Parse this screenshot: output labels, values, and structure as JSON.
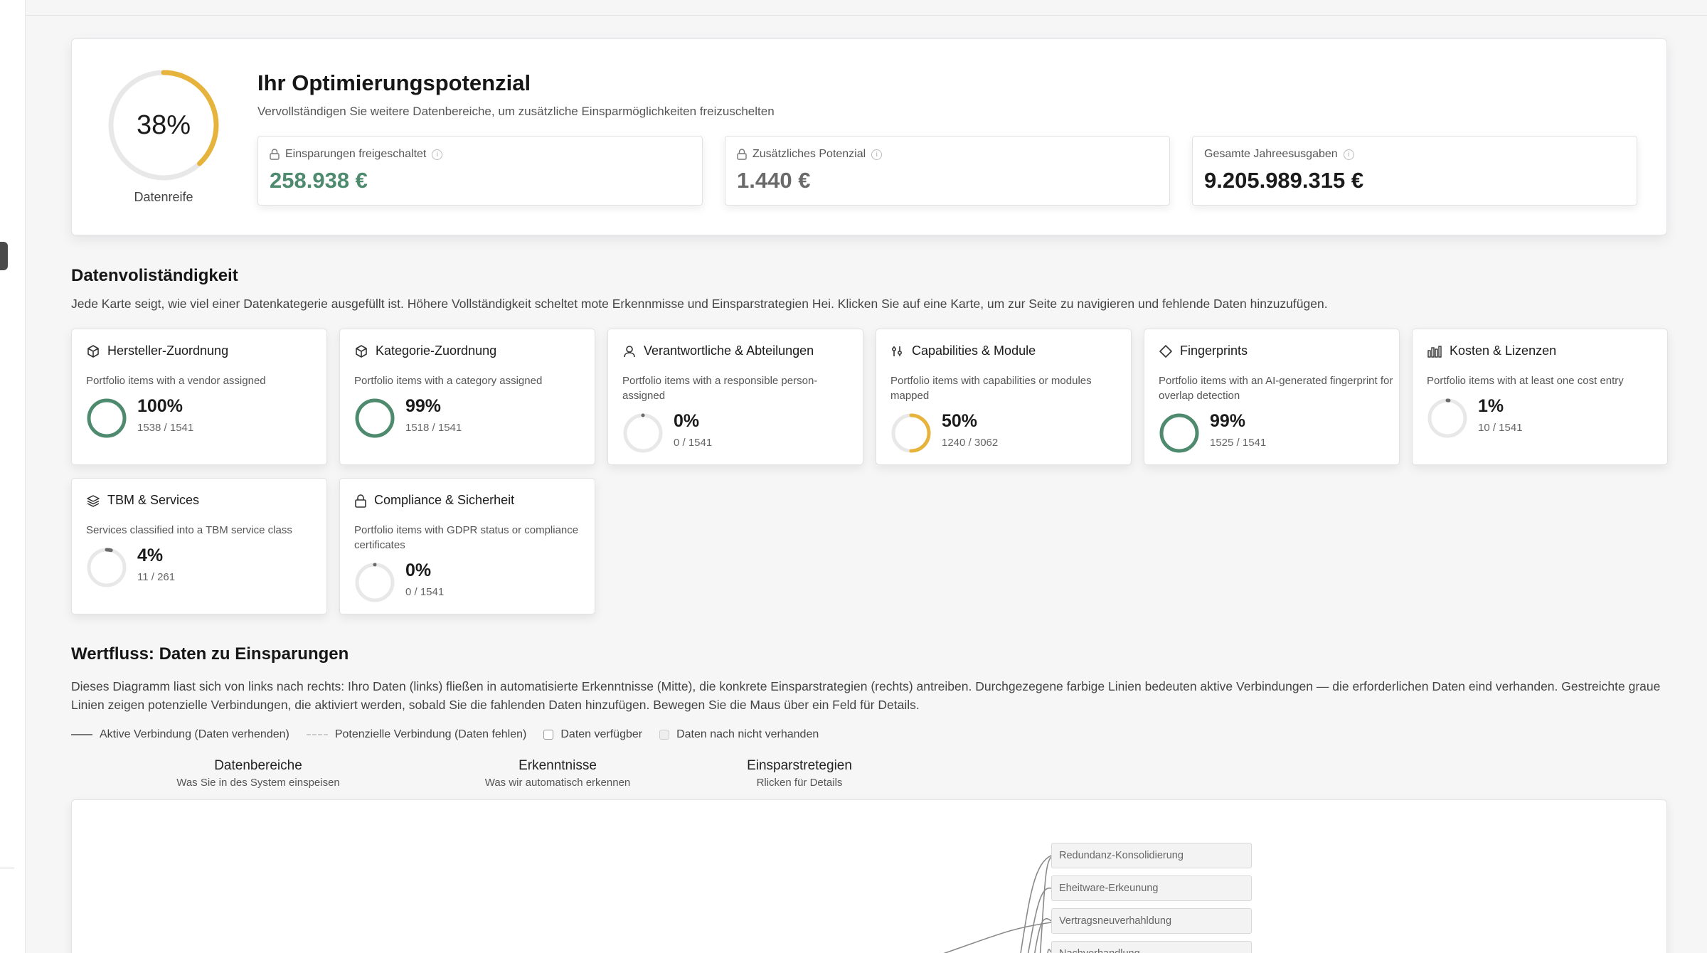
{
  "hero": {
    "maturity_percent": 38,
    "maturity_label": "38%",
    "maturity_caption": "Datenreife",
    "title": "Ihr Optimierungspotenzial",
    "subtitle": "Vervollständigen Sie weitere Datenbereiche, um zusätzliche Einsparmöglichkeiten freizuschelten",
    "stats": [
      {
        "label": "Einsparungen freigeschaltet",
        "value": "258.938 €",
        "color": "#4e8a6e",
        "icon": "lock-icon"
      },
      {
        "label": "Zusätzliches Potenzial",
        "value": "1.440 €",
        "color": "#6a6a6a",
        "icon": "lock-icon"
      },
      {
        "label": "Gesamte Jahreesusgaben",
        "value": "9.205.989.315 €",
        "color": "#1b1b1b",
        "icon": ""
      }
    ]
  },
  "completeness": {
    "title": "Datenvoliständigkeit",
    "description": "Jede Karte seigt, wie viel einer Datenkategerie ausgefüllt ist. Höhere Vollständigkeit scheltet mote Erkennmisse und Einsparstrategien Hei. Klicken Sie auf eine Karte, um zur Seite zu navigieren und fehlende Daten hinzuzufügen.",
    "cards": [
      {
        "title": "Hersteller-Zuordnung",
        "icon": "box-icon",
        "desc": "Portfolio items with a vendor assigned",
        "percent": 100,
        "pct_label": "100%",
        "count": "1538 / 1541"
      },
      {
        "title": "Kategorie-Zuordnung",
        "icon": "box-icon",
        "desc": "Portfolio items with a category assigned",
        "percent": 99,
        "pct_label": "99%",
        "count": "1518 / 1541"
      },
      {
        "title": "Verantwortliche & Abteilungen",
        "icon": "user-icon",
        "desc": "Portfolio items with a responsible person-assigned",
        "percent": 0,
        "pct_label": "0%",
        "count": "0 / 1541"
      },
      {
        "title": "Capabilities & Module",
        "icon": "sliders-icon",
        "desc": "Portfolio items with capabilities or modules mapped",
        "percent": 50,
        "pct_label": "50%",
        "count": "1240 / 3062"
      },
      {
        "title": "Fingerprints",
        "icon": "diamond-icon",
        "desc": "Portfolio items with an AI-generated fingerprint for overlap detection",
        "percent": 99,
        "pct_label": "99%",
        "count": "1525 / 1541"
      },
      {
        "title": "Kosten & Lizenzen",
        "icon": "bar-chart-icon",
        "desc": "Portfolio items with at least one cost entry",
        "percent": 1,
        "pct_label": "1%",
        "count": "10 / 1541"
      },
      {
        "title": "TBM & Services",
        "icon": "layers-icon",
        "desc": "Services classified into a TBM service class",
        "percent": 4,
        "pct_label": "4%",
        "count": "11 / 261"
      },
      {
        "title": "Compliance & Sicherheit",
        "icon": "lock-icon",
        "desc": "Portfolio items with GDPR status or compliance certificates",
        "percent": 0,
        "pct_label": "0%",
        "count": "0 / 1541"
      }
    ]
  },
  "valueflow": {
    "title": "Wertfluss: Daten zu Einsparungen",
    "description": "Dieses Diagramm liast sich von links nach rechts: Ihro Daten (links) fließen in automatisierte Erkenntnisse (Mitte), die konkrete Einsparstrategien (rechts) antreiben. Durchgezegene farbige Linien bedeuten aktive Verbindungen — die erforderlichen Daten eind verhanden. Gestreichte graue Linien zeigen potenzielle Verbindungen, die aktiviert werden, sobald Sie die fahlenden Daten hinzufügen. Bewegen Sie die Maus über ein Feld für Details.",
    "legend": [
      {
        "label": "Aktive Verbindung (Daten verhenden)",
        "kind": "solid"
      },
      {
        "label": "Potenzielle Verbindung (Daten fehlen)",
        "kind": "dashed"
      },
      {
        "label": "Daten verfügber",
        "kind": "box"
      },
      {
        "label": "Daten nach nicht verhanden",
        "kind": "box-dim"
      }
    ],
    "columns": [
      {
        "title": "Datenbereiche",
        "subtitle": "Was Sie in des System einspeisen"
      },
      {
        "title": "Erkenntnisse",
        "subtitle": "Was wir automatisch erkennen"
      },
      {
        "title": "Einsparstretegien",
        "subtitle": "Rlicken für Details"
      }
    ],
    "strategies": [
      "Redundanz-Konsolidierung",
      "Eheitware-Erkeunung",
      "Vertragsneuverhahldung",
      "Nachverhandlung"
    ],
    "colors": {
      "accent_green": "#4e8a6e",
      "ring_yellow": "#e6b43c",
      "ring_track": "#e8e8e8"
    }
  }
}
